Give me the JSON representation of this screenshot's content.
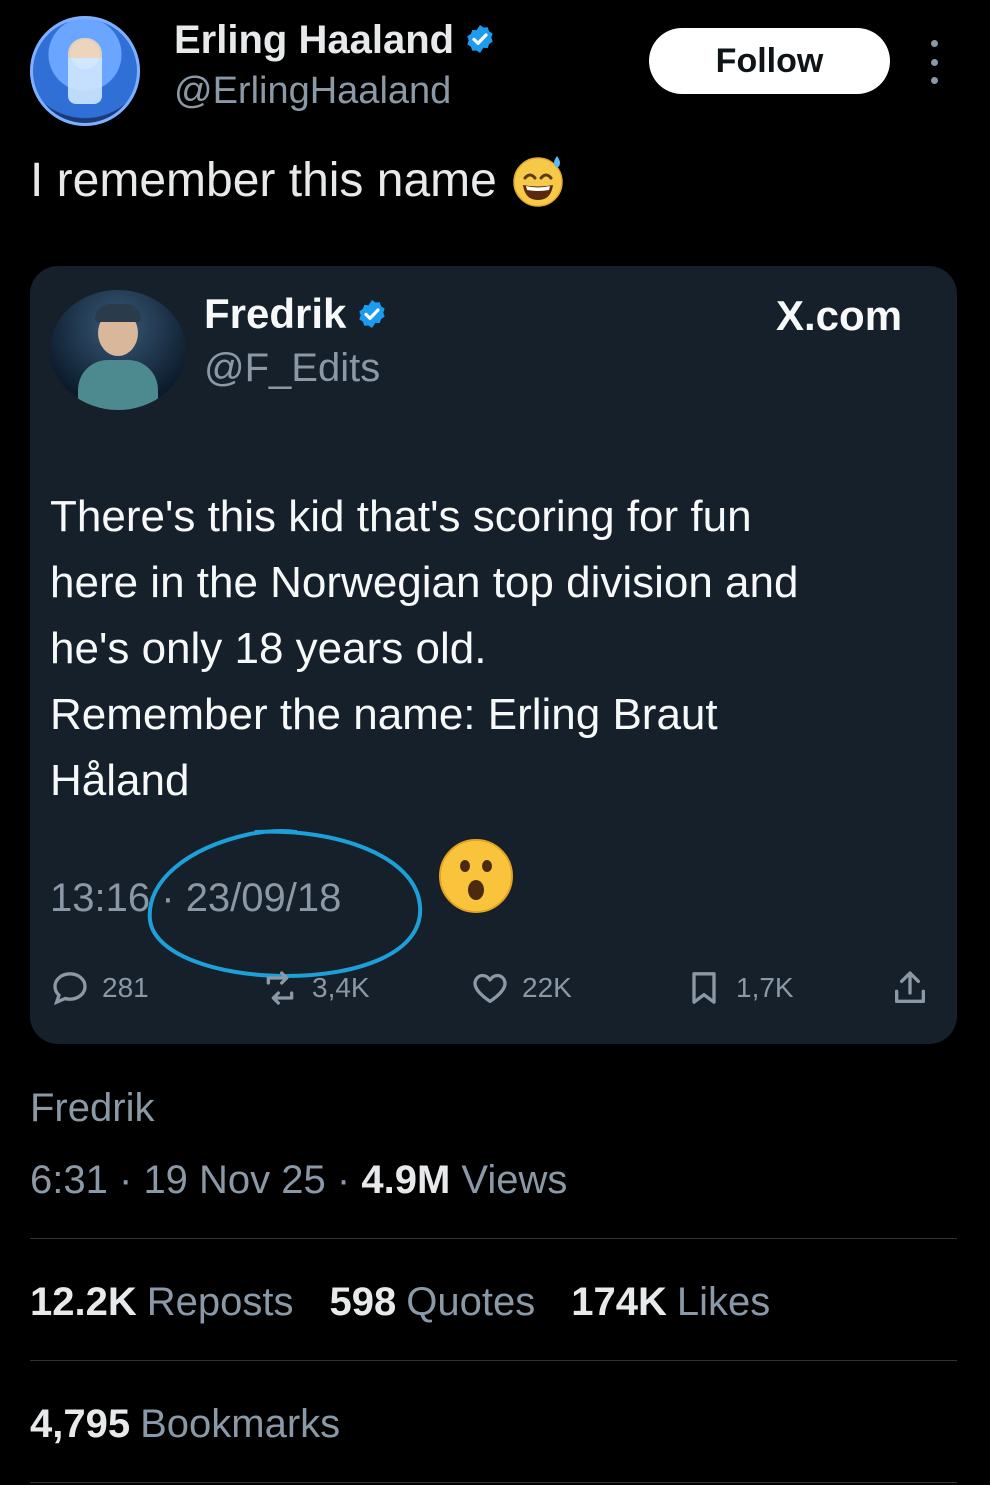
{
  "tweet": {
    "author": {
      "name": "Erling Haaland",
      "handle": "@ErlingHaaland",
      "verified": true
    },
    "follow_label": "Follow",
    "text": "I remember this name",
    "text_emoji": "grinning-sweat-emoji",
    "quoted": {
      "author": {
        "name": "Fredrik",
        "handle": "@F_Edits",
        "verified": true
      },
      "site": "X.com",
      "body": "There's this kid that's scoring for fun\nhere in the Norwegian top division and\nhe's only 18 years old.\nRemember the name: Erling Braut\nHåland",
      "time": "13:16",
      "separator": "·",
      "date": "23/09/18",
      "reaction_emoji": "astonished-emoji",
      "actions": {
        "replies": "281",
        "reposts": "3,4K",
        "likes": "22K",
        "bookmarks": "1,7K"
      }
    },
    "footer": {
      "author_name": "Fredrik",
      "time": "6:31",
      "sep1": "·",
      "date": "19 Nov 25",
      "sep2": "·",
      "views_count": "4.9M",
      "views_label": "Views"
    },
    "stats": {
      "reposts_count": "12.2K",
      "reposts_label": "Reposts",
      "quotes_count": "598",
      "quotes_label": "Quotes",
      "likes_count": "174K",
      "likes_label": "Likes",
      "bookmarks_count": "4,795",
      "bookmarks_label": "Bookmarks"
    }
  },
  "colors": {
    "background": "#000000",
    "card": "#15202b",
    "verified": "#1d9bf0",
    "muted": "#8b98a5",
    "annotation": "#1e9fd8"
  }
}
